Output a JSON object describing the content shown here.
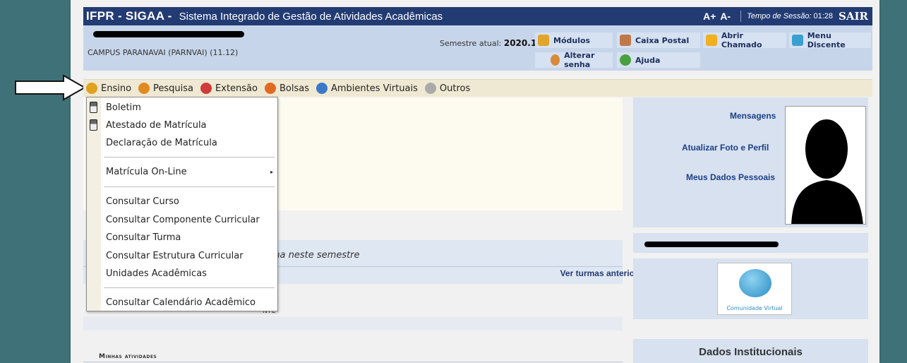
{
  "header": {
    "brand": "IFPR - SIGAA -",
    "system_name": "Sistema Integrado de Gestão de Atividades Acadêmicas",
    "font_increase": "A+",
    "font_decrease": "A-",
    "session_label": "Tempo de Sessão:",
    "session_time": "01:28",
    "logout": "SAIR"
  },
  "info": {
    "campus": "CAMPUS PARANAVAI (PARNVAI) (11.12)",
    "semester_label": "Semestre atual:",
    "semester_value": "2020.1"
  },
  "tools": {
    "modules": "Módulos",
    "mailbox": "Caixa Postal",
    "open_ticket": "Abrir Chamado",
    "student_menu": "Menu Discente",
    "change_password": "Alterar senha",
    "help": "Ajuda"
  },
  "menu": [
    {
      "label": "Ensino",
      "icon": "ensino-icon",
      "color": "#e0a020"
    },
    {
      "label": "Pesquisa",
      "icon": "pesquisa-icon",
      "color": "#e08a20"
    },
    {
      "label": "Extensão",
      "icon": "extensao-icon",
      "color": "#d03a3a"
    },
    {
      "label": "Bolsas",
      "icon": "bolsas-icon",
      "color": "#e06a20"
    },
    {
      "label": "Ambientes Virtuais",
      "icon": "ambientes-icon",
      "color": "#3a78c8"
    },
    {
      "label": "Outros",
      "icon": "outros-icon",
      "color": "#aaaaaa"
    }
  ],
  "dropdown": {
    "items": [
      "Boletim",
      "Atestado de Matrícula",
      "Declaração de Matrícula",
      "Matrícula On-Line",
      "Consultar Curso",
      "Consultar Componente Curricular",
      "Consultar Turma",
      "Consultar Estrutura Curricular",
      "Unidades Acadêmicas",
      "Consultar Calendário Acadêmico"
    ],
    "submenu_arrow": "▸"
  },
  "main": {
    "no_classes": "Nenhuma turma neste semestre",
    "previous_classes": "Ver turmas anteriores",
    "communities_fragment": "NTE",
    "my_activities": "Minhas atividades"
  },
  "profile": {
    "messages": "Mensagens",
    "update_photo": "Atualizar Foto e Perfil",
    "personal_data": "Meus Dados Pessoais",
    "community_label": "Comunidade Virtual",
    "institutional_data": "Dados Institucionais"
  },
  "colors": {
    "header_bg": "#233b73",
    "info_bg": "#c7d5ea",
    "menu_bg": "#efe8d2",
    "link": "#1b3f88"
  }
}
